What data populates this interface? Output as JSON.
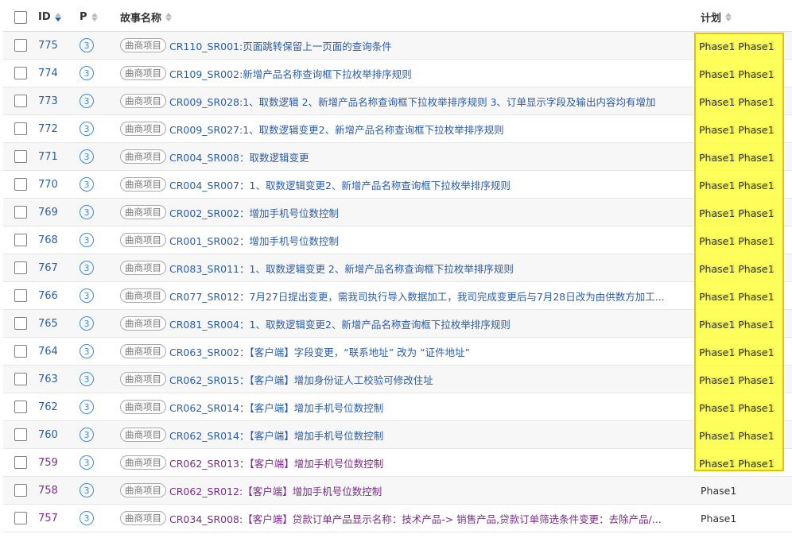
{
  "header": {
    "id": "ID",
    "p": "P",
    "title": "故事名称",
    "plan": "计划"
  },
  "tag_label": "曲商项目",
  "rows": [
    {
      "id": "775",
      "p": "3",
      "title": "CR110_SR001:页面跳转保留上一页面的查询条件",
      "plan": "Phase1 Phase1"
    },
    {
      "id": "774",
      "p": "3",
      "title": "CR109_SR002:新增产品名称查询框下拉枚举排序规则",
      "plan": "Phase1 Phase1"
    },
    {
      "id": "773",
      "p": "3",
      "title": "CR009_SR028:1、取数逻辑 2、新增产品名称查询框下拉枚举排序规则 3、订单显示字段及输出内容均有增加",
      "plan": "Phase1 Phase1"
    },
    {
      "id": "772",
      "p": "3",
      "title": "CR009_SR027:1、取数逻辑变更2、新增产品名称查询框下拉枚举排序规则",
      "plan": "Phase1 Phase1"
    },
    {
      "id": "771",
      "p": "3",
      "title": "CR004_SR008：取数逻辑变更",
      "plan": "Phase1 Phase1"
    },
    {
      "id": "770",
      "p": "3",
      "title": "CR004_SR007：1、取数逻辑变更2、新增产品名称查询框下拉枚举排序规则",
      "plan": "Phase1 Phase1"
    },
    {
      "id": "769",
      "p": "3",
      "title": "CR002_SR002：增加手机号位数控制",
      "plan": "Phase1 Phase1"
    },
    {
      "id": "768",
      "p": "3",
      "title": "CR001_SR002：增加手机号位数控制",
      "plan": "Phase1 Phase1"
    },
    {
      "id": "767",
      "p": "3",
      "title": "CR083_SR011：1、取数逻辑变更 2、新增产品名称查询框下拉枚举排序规则",
      "plan": "Phase1 Phase1"
    },
    {
      "id": "766",
      "p": "3",
      "title": "CR077_SR012：7月27日提出变更，需我司执行导入数据加工，我司完成变更后与7月28日改为由供数方加工...",
      "plan": "Phase1 Phase1"
    },
    {
      "id": "765",
      "p": "3",
      "title": "CR081_SR004：1、取数逻辑变更2、新增产品名称查询框下拉枚举排序规则",
      "plan": "Phase1 Phase1"
    },
    {
      "id": "764",
      "p": "3",
      "title": "CR063_SR002：【客户端】字段变更，“联系地址” 改为 “证件地址”",
      "plan": "Phase1 Phase1"
    },
    {
      "id": "763",
      "p": "3",
      "title": "CR062_SR015：【客户端】增加身份证人工校验可修改住址",
      "plan": "Phase1 Phase1"
    },
    {
      "id": "762",
      "p": "3",
      "title": "CR062_SR014：【客户端】增加手机号位数控制",
      "plan": "Phase1 Phase1"
    },
    {
      "id": "760",
      "p": "3",
      "title": "CR062_SR014：【客户端】增加手机号位数控制",
      "plan": "Phase1 Phase1"
    },
    {
      "id": "759",
      "p": "3",
      "title": "CR062_SR013：【客户端】增加手机号位数控制",
      "plan": "Phase1 Phase1"
    },
    {
      "id": "758",
      "p": "3",
      "title": "CR062_SR012:【客户端】增加手机号位数控制",
      "plan": "Phase1"
    },
    {
      "id": "757",
      "p": "3",
      "title": "CR034_SR008:【客户端】贷款订单产品显示名称：技术产品-> 销售产品,贷款订单筛选条件变更：去除产品/...",
      "plan": "Phase1"
    }
  ],
  "colors": {
    "link": "#2b5ca8",
    "visited": "#7a2d86",
    "highlight": "#ffff40",
    "badge": "#3d8be0"
  }
}
